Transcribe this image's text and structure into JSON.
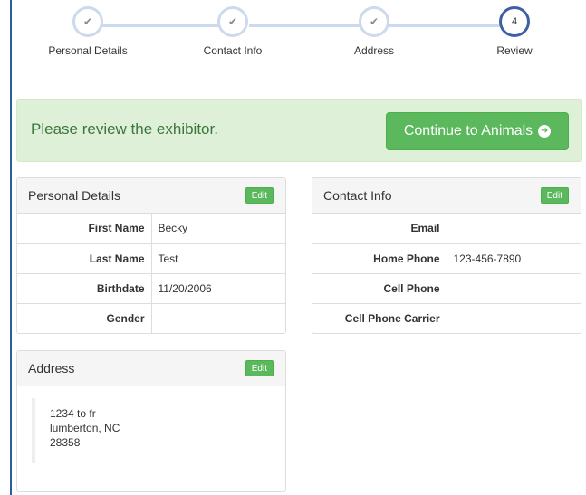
{
  "stepper": {
    "steps": [
      {
        "label": "Personal Details",
        "state": "complete"
      },
      {
        "label": "Contact Info",
        "state": "complete"
      },
      {
        "label": "Address",
        "state": "complete"
      },
      {
        "label": "Review",
        "state": "active",
        "number": "4"
      }
    ],
    "check_glyph": "✔"
  },
  "alert": {
    "message": "Please review the exhibitor.",
    "continue_label": "Continue to Animals",
    "arrow_glyph": "➜"
  },
  "personal": {
    "title": "Personal Details",
    "edit_label": "Edit",
    "rows": [
      {
        "label": "First Name",
        "value": "Becky"
      },
      {
        "label": "Last Name",
        "value": "Test"
      },
      {
        "label": "Birthdate",
        "value": "11/20/2006"
      },
      {
        "label": "Gender",
        "value": ""
      }
    ]
  },
  "contact": {
    "title": "Contact Info",
    "edit_label": "Edit",
    "rows": [
      {
        "label": "Email",
        "value": ""
      },
      {
        "label": "Home Phone",
        "value": "123-456-7890"
      },
      {
        "label": "Cell Phone",
        "value": ""
      },
      {
        "label": "Cell Phone Carrier",
        "value": ""
      }
    ]
  },
  "address": {
    "title": "Address",
    "edit_label": "Edit",
    "lines": [
      "1234 to fr",
      "lumberton, NC",
      "28358"
    ]
  },
  "colors": {
    "accent_green": "#5cb85c",
    "alert_bg": "#dff0d8",
    "alert_text": "#3c763d",
    "step_inactive": "#cdd9ec",
    "step_active": "#3f5fa6"
  }
}
